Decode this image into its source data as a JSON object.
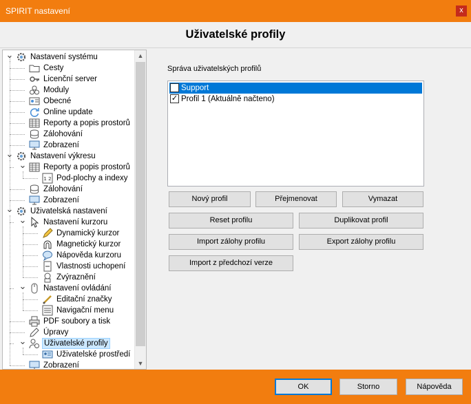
{
  "window": {
    "title": "SPIRIT nastavení",
    "close_glyph": "x"
  },
  "page_title": "Uživatelské profily",
  "tree": {
    "nodes": [
      {
        "label": "Nastavení systému",
        "icon": "gear-icon",
        "level": 0,
        "expanded": true
      },
      {
        "label": "Cesty",
        "icon": "folder-icon",
        "level": 1
      },
      {
        "label": "Licenční server",
        "icon": "key-icon",
        "level": 1
      },
      {
        "label": "Moduly",
        "icon": "modules-icon",
        "level": 1
      },
      {
        "label": "Obecné",
        "icon": "settings-panel-icon",
        "level": 1
      },
      {
        "label": "Online update",
        "icon": "refresh-icon",
        "level": 1
      },
      {
        "label": "Reporty a popis prostorů",
        "icon": "table-icon",
        "level": 1
      },
      {
        "label": "Zálohování",
        "icon": "database-icon",
        "level": 1
      },
      {
        "label": "Zobrazení",
        "icon": "monitor-icon",
        "level": 1
      },
      {
        "label": "Nastavení výkresu",
        "icon": "gear-icon",
        "level": 0,
        "expanded": true
      },
      {
        "label": "Reporty a popis prostorů",
        "icon": "table-icon",
        "level": 1,
        "expanded": true
      },
      {
        "label": "Pod-plochy a indexy",
        "icon": "index-icon",
        "level": 2
      },
      {
        "label": "Zálohování",
        "icon": "database-icon",
        "level": 1
      },
      {
        "label": "Zobrazení",
        "icon": "monitor-icon",
        "level": 1
      },
      {
        "label": "Uživatelská nastavení",
        "icon": "gear-icon",
        "level": 0,
        "expanded": true
      },
      {
        "label": "Nastavení kurzoru",
        "icon": "cursor-icon",
        "level": 1,
        "expanded": true
      },
      {
        "label": "Dynamický kurzor",
        "icon": "pencil-icon",
        "level": 2
      },
      {
        "label": "Magnetický kurzor",
        "icon": "magnet-icon",
        "level": 2
      },
      {
        "label": "Nápověda kurzoru",
        "icon": "tooltip-icon",
        "level": 2
      },
      {
        "label": "Vlastnosti uchopení",
        "icon": "snap-icon",
        "level": 2
      },
      {
        "label": "Zvýraznění",
        "icon": "highlight-icon",
        "level": 2
      },
      {
        "label": "Nastavení ovládání",
        "icon": "mouse-icon",
        "level": 1,
        "expanded": true
      },
      {
        "label": "Editační značky",
        "icon": "edit-marks-icon",
        "level": 2
      },
      {
        "label": "Navigační menu",
        "icon": "menu-icon",
        "level": 2
      },
      {
        "label": "PDF soubory a tisk",
        "icon": "printer-icon",
        "level": 1
      },
      {
        "label": "Úpravy",
        "icon": "pen-icon",
        "level": 1
      },
      {
        "label": "Uživatelské profily",
        "icon": "user-profiles-icon",
        "level": 1,
        "expanded": true,
        "selected": true
      },
      {
        "label": "Uživatelské prostředí",
        "icon": "user-card-icon",
        "level": 2
      },
      {
        "label": "Zobrazení",
        "icon": "monitor-icon",
        "level": 1
      }
    ]
  },
  "panel": {
    "label": "Správa uživatelských profilů",
    "profiles": [
      {
        "name": "Support",
        "checked": false,
        "selected": true
      },
      {
        "name": "Profil 1 (Aktuálně načteno)",
        "checked": true,
        "selected": false
      }
    ],
    "buttons": {
      "new": "Nový profil",
      "rename": "Přejmenovat",
      "delete": "Vymazat",
      "reset": "Reset profilu",
      "duplicate": "Duplikovat profil",
      "import_backup": "Import zálohy profilu",
      "export_backup": "Export zálohy profilu",
      "import_previous": "Import z předchozí verze"
    }
  },
  "footer": {
    "ok": "OK",
    "cancel": "Storno",
    "help": "Nápověda"
  },
  "colors": {
    "accent": "#f27d0f",
    "selection": "#0078d7",
    "tree_selection": "#cce8ff"
  }
}
